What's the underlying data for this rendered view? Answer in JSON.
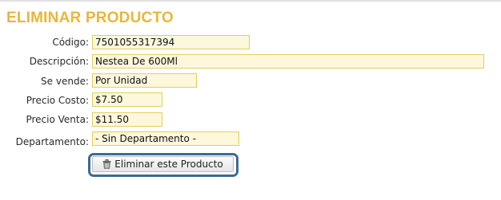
{
  "page": {
    "title": "ELIMINAR PRODUCTO"
  },
  "form": {
    "fields": [
      {
        "label": "Código:",
        "value": "7501055317394"
      },
      {
        "label": "Descripción:",
        "value": "Nestea De 600Ml"
      },
      {
        "label": "Se vende:",
        "value": "Por Unidad"
      },
      {
        "label": "Precio Costo:",
        "value": "$7.50"
      },
      {
        "label": "Precio Venta:",
        "value": "$11.50"
      },
      {
        "label": "Departamento:",
        "value": "- Sin Departamento -"
      }
    ]
  },
  "actions": {
    "delete_label": "Eliminar este Producto",
    "delete_icon": "trash-icon"
  },
  "colors": {
    "title": "#e8b73a",
    "field_border": "#e4cd5e",
    "field_background": "#fdf7dc",
    "focus_ring": "#3c6a93"
  }
}
